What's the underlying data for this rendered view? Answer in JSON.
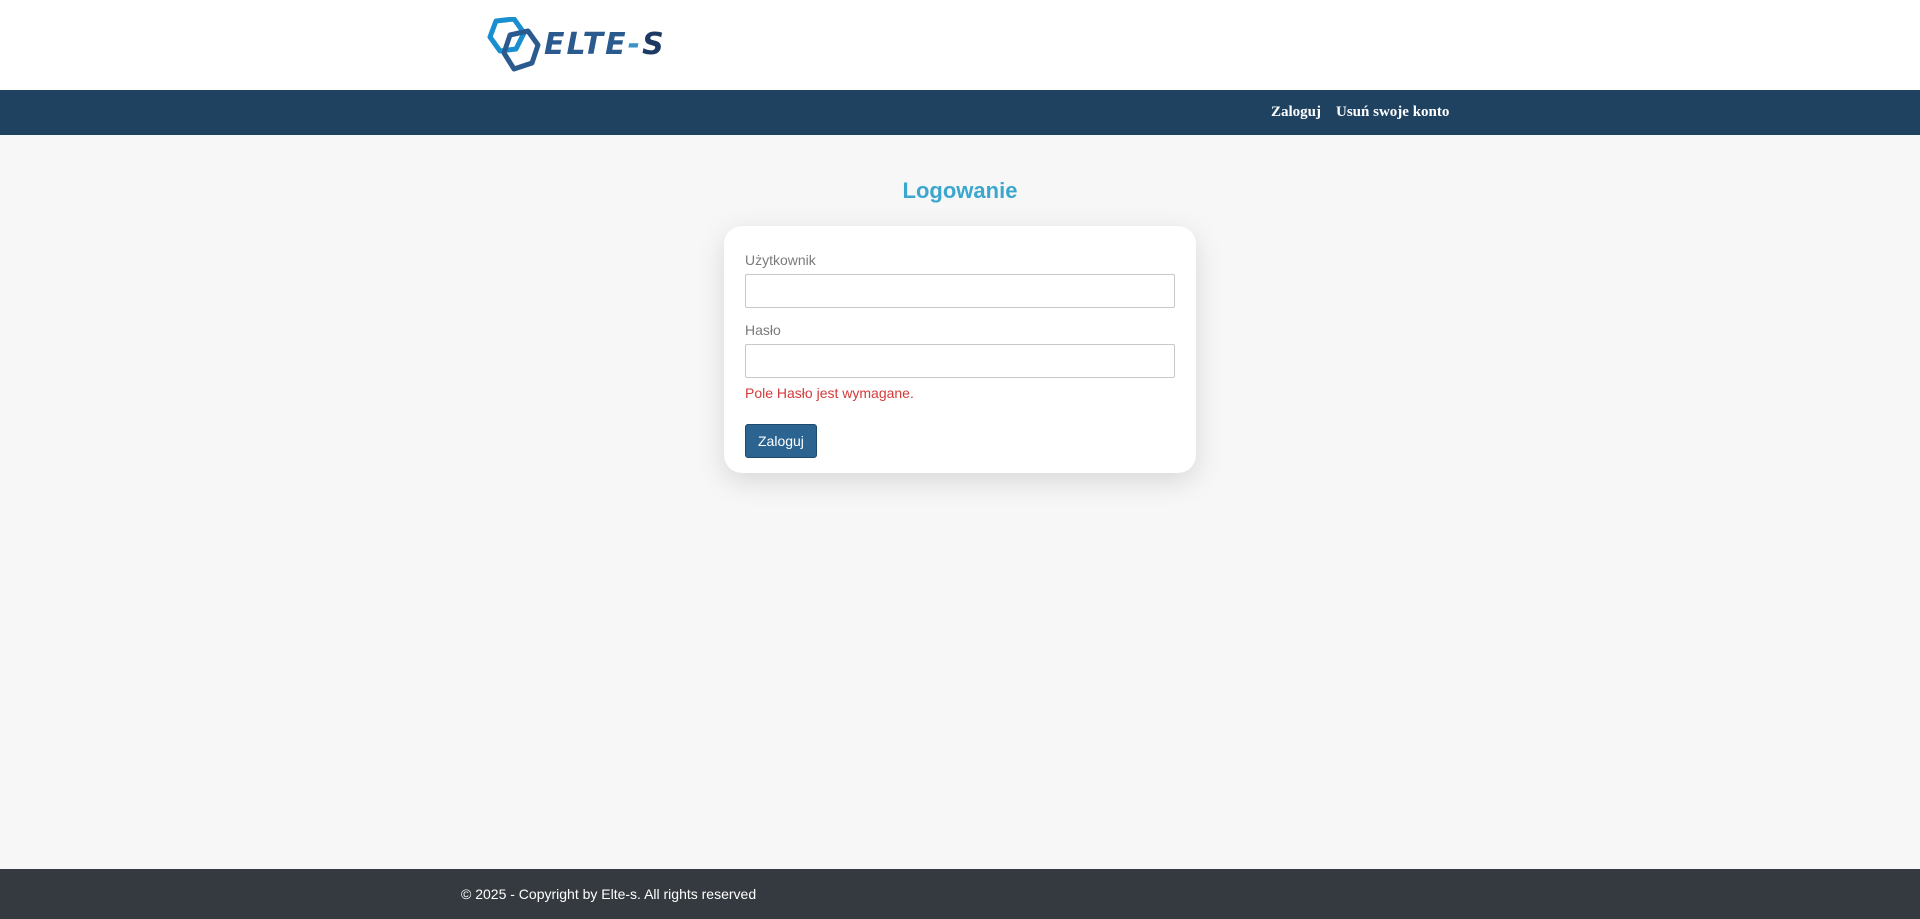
{
  "header": {
    "logo": {
      "text_main": "ELTE",
      "text_dash": "-",
      "text_s": "S",
      "icon": "hexagon-logo-icon"
    }
  },
  "navbar": {
    "links": [
      {
        "label": "Zaloguj"
      },
      {
        "label": "Usuń swoje konto"
      }
    ]
  },
  "main": {
    "title": "Logowanie",
    "form": {
      "username_label": "Użytkownik",
      "username_value": "",
      "password_label": "Hasło",
      "password_value": "",
      "password_error": "Pole Hasło jest wymagane.",
      "submit_label": "Zaloguj"
    }
  },
  "footer": {
    "text": "© 2025 - Copyright by Elte-s. All rights reserved"
  },
  "colors": {
    "navbar": "#1f4260",
    "title": "#3ba7cf",
    "error": "#d43a3a",
    "button": "#2b6491",
    "footer": "#343a40"
  }
}
